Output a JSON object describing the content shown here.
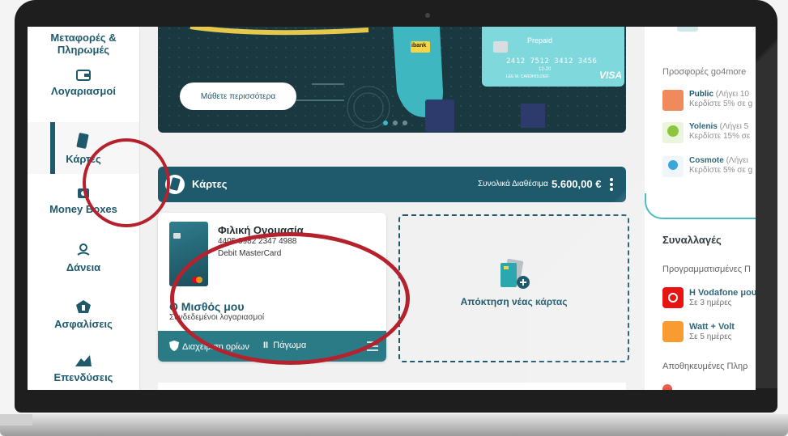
{
  "sidebar": {
    "items": [
      {
        "label": "Μεταφορές & Πληρωμές",
        "icon": "transfers-icon"
      },
      {
        "label": "Λογαριασμοί",
        "icon": "wallet-icon"
      },
      {
        "label": "Κάρτες",
        "icon": "card-icon"
      },
      {
        "label": "Money Boxes",
        "icon": "money-box-icon"
      },
      {
        "label": "Δάνεια",
        "icon": "loan-icon"
      },
      {
        "label": "Ασφαλίσεις",
        "icon": "insurance-icon"
      },
      {
        "label": "Επενδύσεις",
        "icon": "investments-icon"
      }
    ]
  },
  "banner": {
    "button_label": "Μάθετε περισσότερα",
    "card_prepaid": "Prepaid",
    "card_number": "2412 7512 3412 3456",
    "card_expiry": "12-20",
    "card_holder": "LEE M. CARDHOLDER",
    "card_brand": "VISA",
    "band_label": "ibank"
  },
  "cards_section": {
    "title": "Κάρτες",
    "total_label": "Συνολικά Διαθέσιμα",
    "total_value": "5.600,00 €"
  },
  "card": {
    "name": "Φιλική Ονομασία",
    "number": "4405 3982 2347 4988",
    "type": "Debit MasterCard",
    "account": "Ο Μισθός μου",
    "account_sub": "Συνδεδεμένοι λογαριασμοί",
    "limits_label": "Διαχείριση ορίων",
    "freeze_label": "Πάγωμα"
  },
  "new_card": {
    "label": "Απόκτηση νέας κάρτας"
  },
  "offers": {
    "title": "Προσφορές go4more",
    "items": [
      {
        "name": "Public",
        "expiry": "(Λήγει 10",
        "desc": "Κερδίστε 5% σε g",
        "color": "#f08a5d"
      },
      {
        "name": "Yolenis",
        "expiry": "(Λήγει 5",
        "desc": "Κερδίστε 15% σε",
        "color": "#8cc63f"
      },
      {
        "name": "Cosmote",
        "expiry": "(Λήγει",
        "desc": "Κερδίστε 5% σε g",
        "color": "#2a9fd6"
      }
    ]
  },
  "transactions": {
    "title": "Συναλλαγές",
    "scheduled_label": "Προγραμματισμένες Π",
    "items": [
      {
        "name": "Η Vodafone μου",
        "when": "Σε 3 ημέρες",
        "color": "#e60000"
      },
      {
        "name": "Watt + Volt",
        "when": "Σε 5 ημέρες",
        "color": "#f7931e"
      }
    ],
    "saved_label": "Αποθηκευμένες Πληρ"
  }
}
